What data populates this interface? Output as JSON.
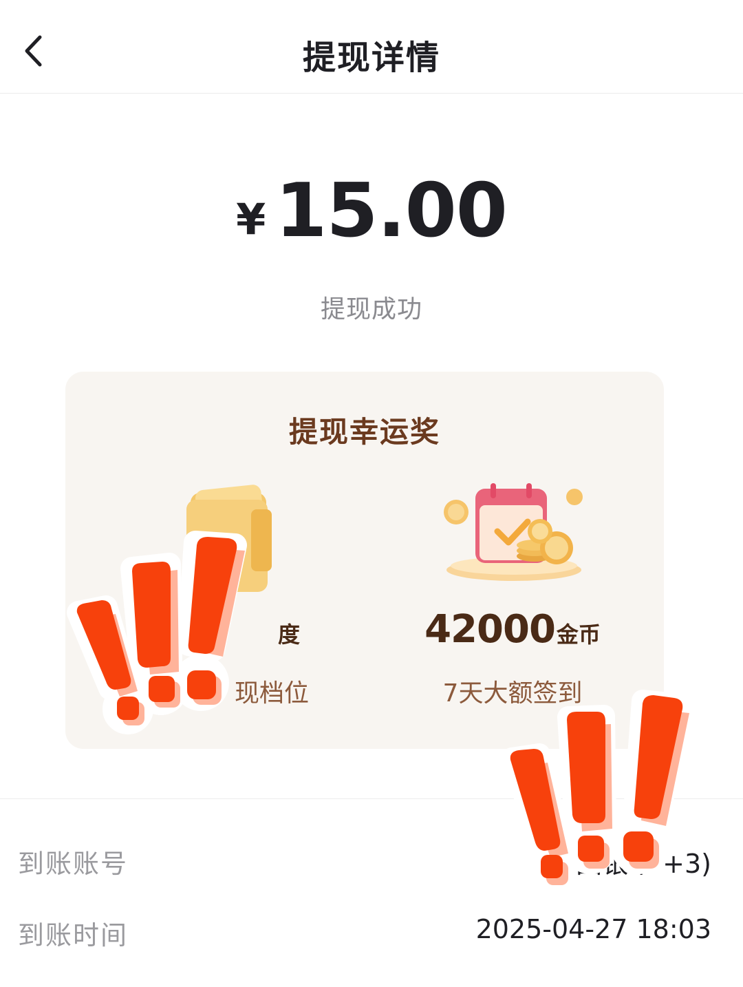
{
  "header": {
    "title": "提现详情",
    "back_icon": "chevron-left-icon"
  },
  "amount": {
    "symbol": "¥",
    "value": "15.00"
  },
  "status": "提现成功",
  "reward_card": {
    "title": "提现幸运奖",
    "items": [
      {
        "icon": "wallet-icon",
        "value": "",
        "unit": "度",
        "description": "现档位"
      },
      {
        "icon": "calendar-coins-icon",
        "value": "42000",
        "unit": "金币",
        "description": "7天大额签到"
      }
    ]
  },
  "details": {
    "rows": [
      {
        "label": "到账账号",
        "value": "中国银彳                    ‌+3)"
      },
      {
        "label": "到账时间",
        "value": "2025-04-27 18:03"
      }
    ]
  },
  "colors": {
    "reward_title": "#6b3a1f",
    "card_bg": "#f8f5f1",
    "sticker": "#f7410c"
  }
}
